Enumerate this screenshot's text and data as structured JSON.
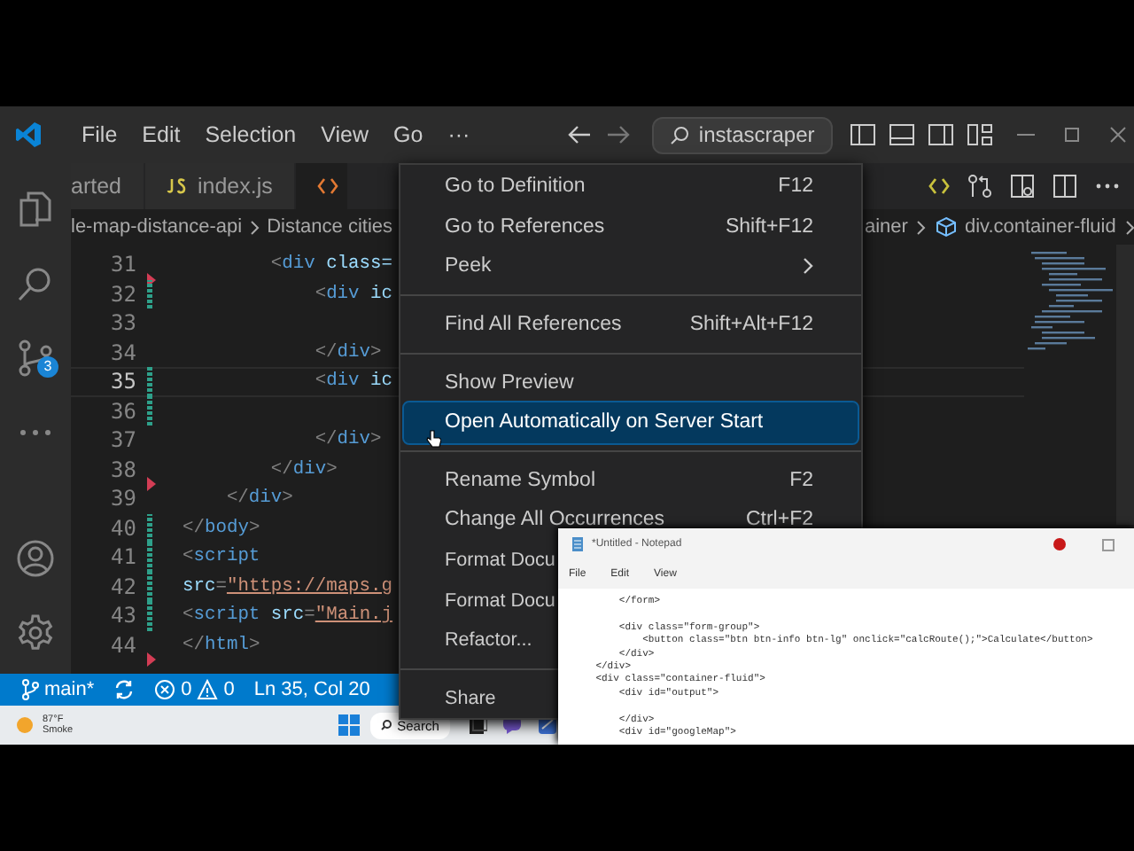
{
  "titlebar": {
    "menus": [
      "File",
      "Edit",
      "Selection",
      "View",
      "Go",
      "···"
    ],
    "search": "instascraper"
  },
  "activity_bar": {
    "source_control_badge": "3"
  },
  "tabs": [
    {
      "label": "arted",
      "kind": "plain",
      "selected": false
    },
    {
      "label": "index.js",
      "kind": "js",
      "selected": false
    },
    {
      "kind": "html",
      "selected": true
    }
  ],
  "breadcrumbs": {
    "left": [
      "le-map-distance-api",
      "Distance cities"
    ],
    "right": [
      "ainer",
      "div.container-fluid"
    ]
  },
  "editor": {
    "lines": [
      {
        "number": "31",
        "current": false,
        "modified": false,
        "deleted": true,
        "tokens": [
          {
            "kind": "punct",
            "text": "        <"
          },
          {
            "kind": "tag",
            "text": "div"
          },
          {
            "kind": "attr",
            "text": " class="
          }
        ]
      },
      {
        "number": "32",
        "current": false,
        "modified": true,
        "deleted": false,
        "tokens": [
          {
            "kind": "punct",
            "text": "            <"
          },
          {
            "kind": "tag",
            "text": "div"
          },
          {
            "kind": "attr",
            "text": " ic"
          }
        ]
      },
      {
        "number": "33",
        "current": false,
        "modified": false,
        "deleted": false
      },
      {
        "number": "34",
        "current": false,
        "modified": false,
        "deleted": false,
        "tokens": [
          {
            "kind": "punct",
            "text": "            </"
          },
          {
            "kind": "tag",
            "text": "div"
          },
          {
            "kind": "punct",
            "text": ">"
          }
        ]
      },
      {
        "number": "35",
        "current": true,
        "modified": true,
        "deleted": false,
        "tokens": [
          {
            "kind": "punct",
            "text": "            <"
          },
          {
            "kind": "tag",
            "text": "div"
          },
          {
            "kind": "attr",
            "text": " ic"
          }
        ]
      },
      {
        "number": "36",
        "current": false,
        "modified": true,
        "deleted": false
      },
      {
        "number": "37",
        "current": false,
        "modified": false,
        "deleted": false,
        "tokens": [
          {
            "kind": "punct",
            "text": "            </"
          },
          {
            "kind": "tag",
            "text": "div"
          },
          {
            "kind": "punct",
            "text": ">"
          }
        ]
      },
      {
        "number": "38",
        "current": false,
        "modified": false,
        "deleted": true,
        "tokens": [
          {
            "kind": "punct",
            "text": "        </"
          },
          {
            "kind": "tag",
            "text": "div"
          },
          {
            "kind": "punct",
            "text": ">"
          }
        ]
      },
      {
        "number": "39",
        "current": false,
        "modified": false,
        "deleted": false,
        "tokens": [
          {
            "kind": "punct",
            "text": "    </"
          },
          {
            "kind": "tag",
            "text": "div"
          },
          {
            "kind": "punct",
            "text": ">"
          }
        ]
      },
      {
        "number": "40",
        "current": false,
        "modified": true,
        "deleted": false,
        "tokens": [
          {
            "kind": "punct",
            "text": "</"
          },
          {
            "kind": "tag",
            "text": "body"
          },
          {
            "kind": "punct",
            "text": ">"
          }
        ]
      },
      {
        "number": "41",
        "current": false,
        "modified": true,
        "deleted": false,
        "tokens": [
          {
            "kind": "punct",
            "text": "<"
          },
          {
            "kind": "tag",
            "text": "script"
          }
        ]
      },
      {
        "number": "42",
        "current": false,
        "modified": true,
        "deleted": false,
        "tokens": [
          {
            "kind": "attr",
            "text": "src"
          },
          {
            "kind": "punct",
            "text": "="
          },
          {
            "kind": "link",
            "text": "\"https://maps.g"
          }
        ]
      },
      {
        "number": "43",
        "current": false,
        "modified": true,
        "deleted": false,
        "tokens": [
          {
            "kind": "punct",
            "text": "<"
          },
          {
            "kind": "tag",
            "text": "script"
          },
          {
            "kind": "attr",
            "text": " src"
          },
          {
            "kind": "punct",
            "text": "="
          },
          {
            "kind": "link",
            "text": "\"Main.j"
          }
        ]
      },
      {
        "number": "44",
        "current": false,
        "modified": false,
        "deleted": true,
        "tokens": [
          {
            "kind": "punct",
            "text": "</"
          },
          {
            "kind": "tag",
            "text": "html"
          },
          {
            "kind": "punct",
            "text": ">"
          }
        ]
      }
    ]
  },
  "context_menu": {
    "items": [
      {
        "kind": "item",
        "label": "Go to Definition",
        "shortcut": "F12",
        "selected": false
      },
      {
        "kind": "item",
        "label": "Go to References",
        "shortcut": "Shift+F12",
        "selected": false
      },
      {
        "kind": "submenu",
        "label": "Peek",
        "selected": false
      },
      {
        "kind": "separator"
      },
      {
        "kind": "item",
        "label": "Find All References",
        "shortcut": "Shift+Alt+F12",
        "selected": false
      },
      {
        "kind": "separator"
      },
      {
        "kind": "item",
        "label": "Show Preview",
        "selected": false
      },
      {
        "kind": "item",
        "label": "Open Automatically on Server Start",
        "selected": true
      },
      {
        "kind": "separator"
      },
      {
        "kind": "item",
        "label": "Rename Symbol",
        "shortcut": "F2",
        "selected": false
      },
      {
        "kind": "item",
        "label": "Change All Occurrences",
        "shortcut": "Ctrl+F2",
        "selected": false
      },
      {
        "kind": "item",
        "label": "Format Docu",
        "selected": false
      },
      {
        "kind": "item",
        "label": "Format Docu",
        "selected": false
      },
      {
        "kind": "item",
        "label": "Refactor...",
        "selected": false
      },
      {
        "kind": "separator"
      },
      {
        "kind": "item",
        "label": "Share",
        "selected": false
      }
    ]
  },
  "status_bar": {
    "branch": "main*",
    "errors": "0",
    "warnings": "0",
    "position": "Ln 35, Col 20"
  },
  "taskbar": {
    "weather_temp": "87°F",
    "weather_text": "Smoke",
    "search": "Search"
  },
  "notepad": {
    "title": "*Untitled - Notepad",
    "menus": [
      "File",
      "Edit",
      "View"
    ],
    "text": "        </form>\n\n        <div class=\"form-group\">\n            <button class=\"btn btn-info btn-lg\" onclick=\"calcRoute();\">Calculate</button>\n        </div>\n    </div>\n    <div class=\"container-fluid\">\n        <div id=\"output\">\n\n        </div>\n        <div id=\"googleMap\">"
  }
}
